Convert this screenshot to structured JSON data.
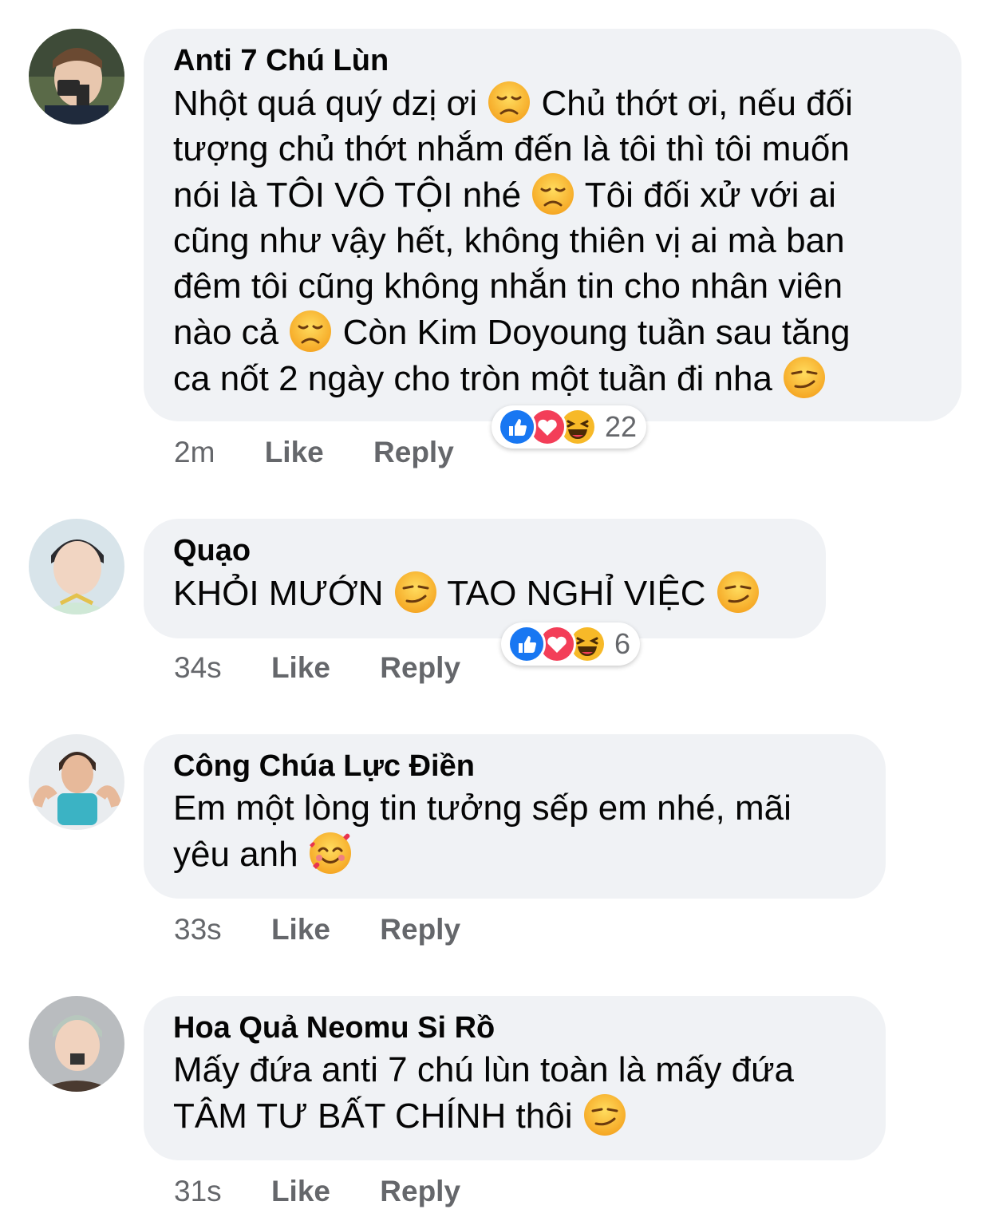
{
  "comments": [
    {
      "author": "Anti 7 Chú Lùn",
      "lines": [
        [
          "Nhột quá quý dzị ơi ",
          "disappointed-face-emoji",
          " Chủ thớt ơi, nếu đối"
        ],
        [
          "tượng chủ thớt nhắm đến là tôi thì tôi muốn"
        ],
        [
          "nói là TÔI VÔ TỘI nhé ",
          "disappointed-face-emoji",
          " Tôi đối xử với ai"
        ],
        [
          "cũng như vậy hết, không thiên vị ai mà ban"
        ],
        [
          "đêm tôi cũng không nhắn tin cho nhân viên"
        ],
        [
          "nào cả ",
          "disappointed-face-emoji",
          " Còn Kim Doyoung tuần sau tăng"
        ],
        [
          "ca nốt 2 ngày cho tròn một tuần đi nha ",
          "smirking-face-emoji"
        ]
      ],
      "time": "2m",
      "like": "Like",
      "reply": "Reply",
      "reactions": {
        "icons": [
          "like-reaction-icon",
          "love-reaction-icon",
          "haha-reaction-icon"
        ],
        "count": "22"
      }
    },
    {
      "author": "Quạo",
      "lines": [
        [
          "KHỎI MƯỚN ",
          "smirking-face-emoji",
          " TAO NGHỈ VIỆC ",
          "smirking-face-emoji"
        ]
      ],
      "time": "34s",
      "like": "Like",
      "reply": "Reply",
      "reactions": {
        "icons": [
          "like-reaction-icon",
          "love-reaction-icon",
          "haha-reaction-icon"
        ],
        "count": "6"
      }
    },
    {
      "author": "Công Chúa Lực Điền",
      "lines": [
        [
          "Em một lòng tin tưởng sếp em nhé, mãi"
        ],
        [
          "yêu anh ",
          "smiling-face-with-hearts-emoji"
        ]
      ],
      "time": "33s",
      "like": "Like",
      "reply": "Reply"
    },
    {
      "author": "Hoa Quả Neomu Si Rồ",
      "lines": [
        [
          "Mấy đứa anti 7 chú lùn toàn là mấy đứa"
        ],
        [
          "TÂM TƯ BẤT CHÍNH thôi ",
          "smirking-face-emoji"
        ]
      ],
      "time": "31s",
      "like": "Like",
      "reply": "Reply"
    }
  ],
  "colors": {
    "bubble": "#f0f2f5",
    "meta_text": "#65676b",
    "like_blue": "#1877f2",
    "love_red": "#f33e58",
    "haha_yellow": "#f7b928"
  }
}
